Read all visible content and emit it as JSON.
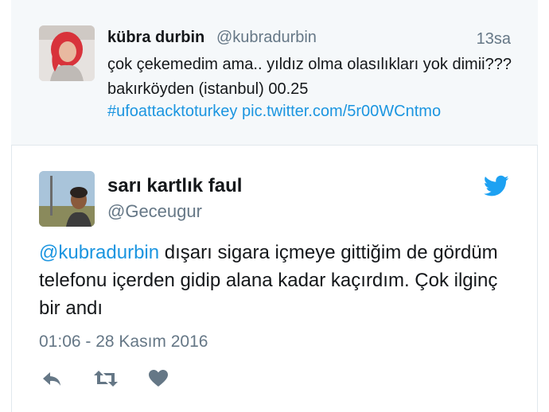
{
  "parent_tweet": {
    "author_name": "kübra durbin",
    "author_handle": "@kubradurbin",
    "time": "13sa",
    "text": "çok çekemedim ama.. yıldız olma olasılıkları yok dimii??? bakırköyden (istanbul) 00.25",
    "hashtag": "#ufoattacktoturkey",
    "pic_link": "pic.twitter.com/5r00WCntmo"
  },
  "tweet": {
    "author_name": "sarı kartlık faul",
    "author_handle": "@Geceugur",
    "mention": "@kubradurbin",
    "text": " dışarı sigara içmeye gittiğim de gördüm telefonu içerden gidip alana kadar kaçırdım. Çok ilginç bir andı",
    "date": "01:06 - 28 Kasım 2016"
  },
  "icons": {
    "brand": "twitter-bird-icon",
    "reply": "reply-icon",
    "retweet": "retweet-icon",
    "like": "heart-icon"
  },
  "colors": {
    "link": "#1b95e0",
    "secondary_text": "#657786",
    "action_icon": "#657786",
    "parent_background": "#f5f8fa"
  }
}
